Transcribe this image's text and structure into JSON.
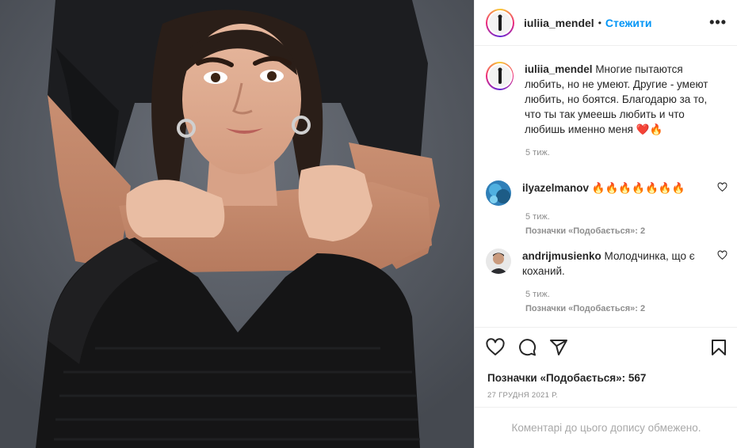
{
  "post": {
    "username": "iuliia_mendel",
    "separator": "•",
    "follow_label": "Стежити",
    "more_label": "•••",
    "caption_username": "iuliia_mendel",
    "caption_text": "Многие пытаются любить, но не умеют. Другие - умеют любить, но боятся. Благодарю за то, что ты так умеешь любить и что любишь именно меня",
    "caption_emoji": "❤️🔥",
    "caption_time": "5 тиж.",
    "likes_label": "Позначки «Подобається»: 567",
    "date": "27 ГРУДНЯ 2021 Р.",
    "comments_closed": "Коментарі до цього допису обмежено."
  },
  "comments": [
    {
      "username": "ilyazelmanov",
      "text": "🔥🔥🔥🔥🔥🔥🔥",
      "time": "5 тиж.",
      "likes": "Позначки «Подобається»: 2"
    },
    {
      "username": "andrijmusienko",
      "text": "Молодчинка, що є коханий.",
      "time": "5 тиж.",
      "likes": "Позначки «Подобається»: 2"
    }
  ],
  "colors": {
    "accent": "#0095f6",
    "text": "#262626",
    "muted": "#8e8e8e",
    "border": "#efefef"
  },
  "icons": [
    "heart-icon",
    "comment-icon",
    "share-icon",
    "bookmark-icon",
    "more-icon"
  ]
}
